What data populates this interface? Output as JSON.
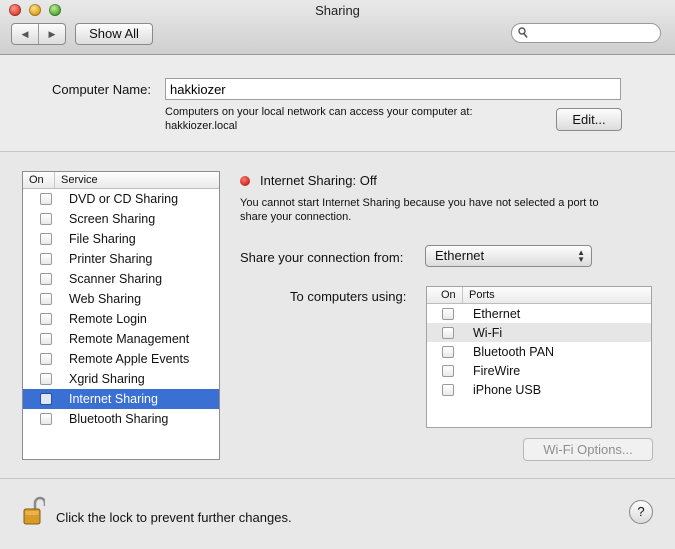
{
  "window": {
    "title": "Sharing"
  },
  "toolbar": {
    "show_all_label": "Show All",
    "search_placeholder": ""
  },
  "computer_name": {
    "label": "Computer Name:",
    "value": "hakkiozer",
    "info_line1": "Computers on your local network can access your computer at:",
    "info_line2": "hakkiozer.local",
    "edit_label": "Edit..."
  },
  "services": {
    "header_on": "On",
    "header_service": "Service",
    "items": [
      {
        "label": "DVD or CD Sharing"
      },
      {
        "label": "Screen Sharing"
      },
      {
        "label": "File Sharing"
      },
      {
        "label": "Printer Sharing"
      },
      {
        "label": "Scanner Sharing"
      },
      {
        "label": "Web Sharing"
      },
      {
        "label": "Remote Login"
      },
      {
        "label": "Remote Management"
      },
      {
        "label": "Remote Apple Events"
      },
      {
        "label": "Xgrid Sharing"
      },
      {
        "label": "Internet Sharing"
      },
      {
        "label": "Bluetooth Sharing"
      }
    ],
    "selected": "Internet Sharing"
  },
  "detail": {
    "status_title": "Internet Sharing: Off",
    "status_color": "#d22a20",
    "desc_line1": "You cannot start Internet Sharing because you have not selected a port to",
    "desc_line2": "share your connection.",
    "share_from_label": "Share your connection from:",
    "share_from_value": "Ethernet",
    "to_computers_label": "To computers using:",
    "ports_header_on": "On",
    "ports_header_ports": "Ports",
    "ports": [
      {
        "label": "Ethernet"
      },
      {
        "label": "Wi-Fi"
      },
      {
        "label": "Bluetooth PAN"
      },
      {
        "label": "FireWire"
      },
      {
        "label": "iPhone USB"
      }
    ],
    "wifi_options_label": "Wi-Fi Options..."
  },
  "footer": {
    "lock_text": "Click the lock to prevent further changes.",
    "help_label": "?"
  },
  "colors": {
    "selection": "#3a70d4"
  }
}
